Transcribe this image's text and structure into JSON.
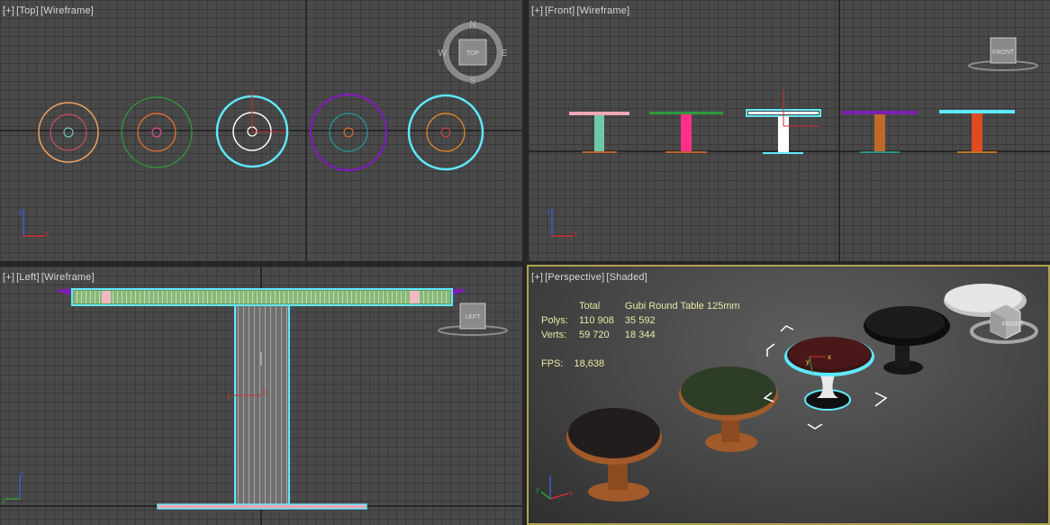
{
  "viewports": {
    "top": {
      "plus": "[+]",
      "view": "[Top]",
      "mode": "[Wireframe]",
      "compass": {
        "n": "N",
        "s": "S",
        "e": "E",
        "w": "W",
        "cube": "TOP"
      }
    },
    "front": {
      "plus": "[+]",
      "view": "[Front]",
      "mode": "[Wireframe]",
      "cube": "FRONT"
    },
    "left": {
      "plus": "[+]",
      "view": "[Left]",
      "mode": "[Wireframe]",
      "cube": "LEFT"
    },
    "perspective": {
      "plus": "[+]",
      "view": "[Perspective]",
      "mode": "[Shaded]",
      "cube": "FRONT"
    }
  },
  "stats": {
    "col_total": "Total",
    "col_object": "Gubi Round Table 125mm",
    "polys_label": "Polys:",
    "polys_total": "110 908",
    "polys_object": "35 592",
    "verts_label": "Verts:",
    "verts_total": "59 720",
    "verts_object": "18 344",
    "fps_label": "FPS:",
    "fps_value": "18,638"
  },
  "axis": {
    "x": "x",
    "y": "y",
    "z": "z"
  },
  "colors": {
    "active_border": "#b0a24d",
    "selection": "#5fe9ff",
    "stats_text": "#e9e9a6",
    "table1": "#f0a060",
    "table2": "#2f9a3a",
    "table4": "#7a1fb0",
    "table5": "#5fe9ff"
  }
}
